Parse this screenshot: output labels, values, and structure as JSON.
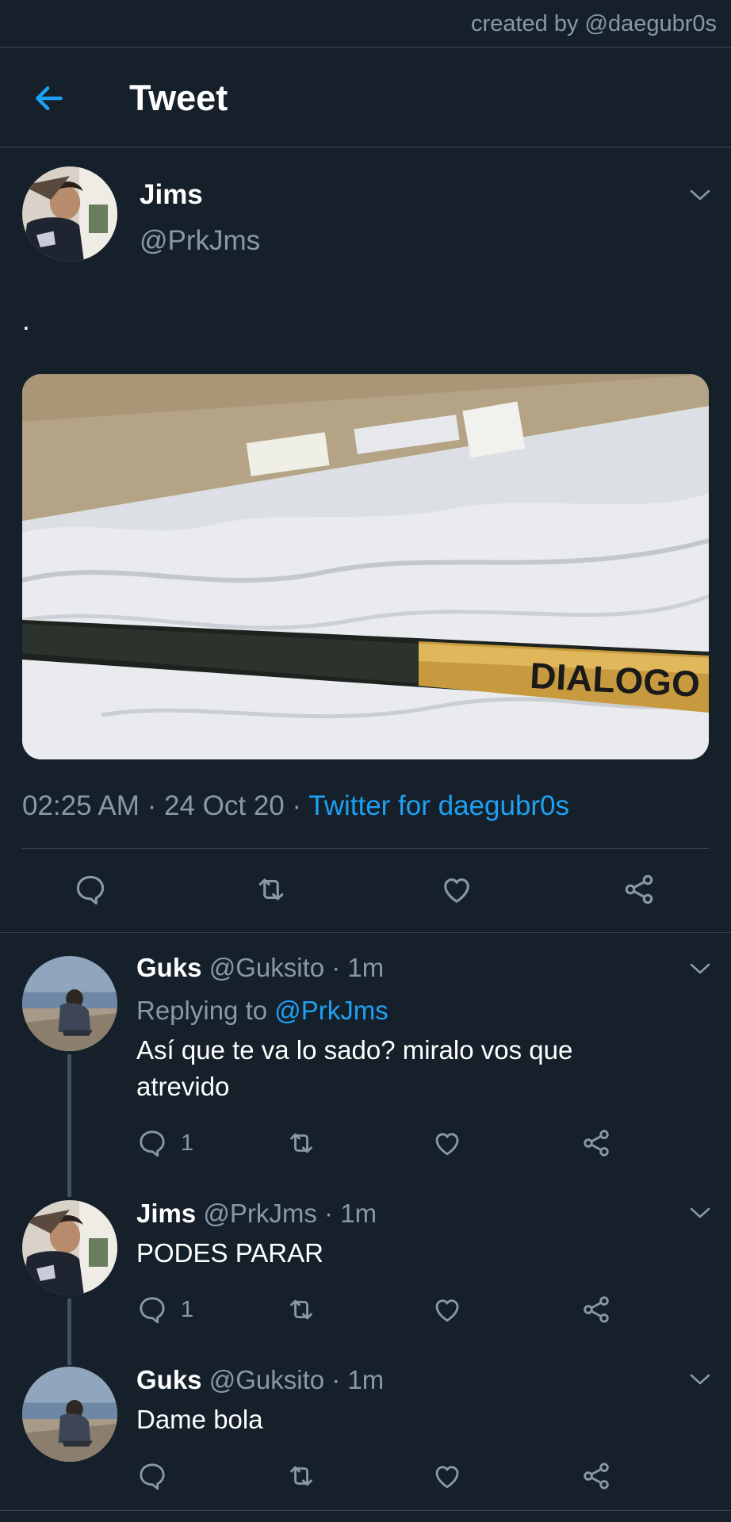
{
  "watermark": "created by @daegubr0s",
  "header": {
    "title": "Tweet"
  },
  "main_tweet": {
    "name": "Jims",
    "handle": "@PrkJms",
    "text": ".",
    "media_label": "DIALOGO",
    "time": "02:25 AM",
    "date": "24 Oct 20",
    "source": "Twitter for daegubr0s"
  },
  "replies": [
    {
      "name": "Guks",
      "handle": "@Guksito",
      "age": "1m",
      "replying_prefix": "Replying to",
      "replying_to": "@PrkJms",
      "text": "Así que te va lo sado? miralo vos que atrevido",
      "reply_count": "1"
    },
    {
      "name": "Jims",
      "handle": "@PrkJms",
      "age": "1m",
      "text": "PODES PARAR",
      "reply_count": "1"
    },
    {
      "name": "Guks",
      "handle": "@Guksito",
      "age": "1m",
      "text": "Dame bola",
      "reply_count": ""
    }
  ],
  "icons": {
    "back": "arrow-left-icon",
    "more": "chevron-down-icon",
    "reply": "comment-icon",
    "retweet": "retweet-icon",
    "like": "heart-icon",
    "share": "share-icon"
  },
  "colors": {
    "background": "#15202b",
    "accent": "#1da1f2",
    "secondary_text": "#8899a6",
    "divider": "#38444d"
  }
}
